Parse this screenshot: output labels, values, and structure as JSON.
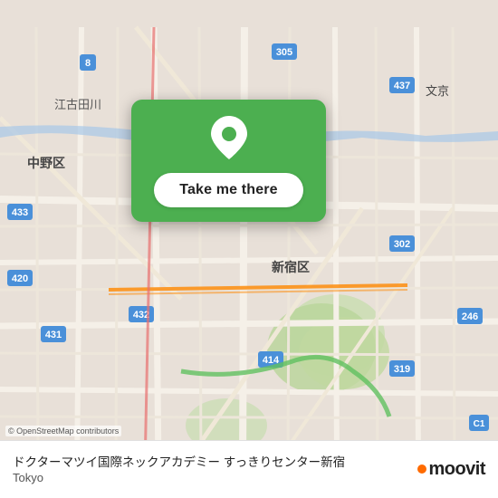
{
  "map": {
    "backgroundColor": "#e8e0d8",
    "attribution": "© OpenStreetMap contributors"
  },
  "popup": {
    "button_label": "Take me there",
    "pin_color": "#ffffff"
  },
  "place": {
    "name": "ドクターマツイ国際ネックアカデミー すっきりセンター新宿",
    "city": "Tokyo"
  },
  "logo": {
    "text": "moovit"
  }
}
